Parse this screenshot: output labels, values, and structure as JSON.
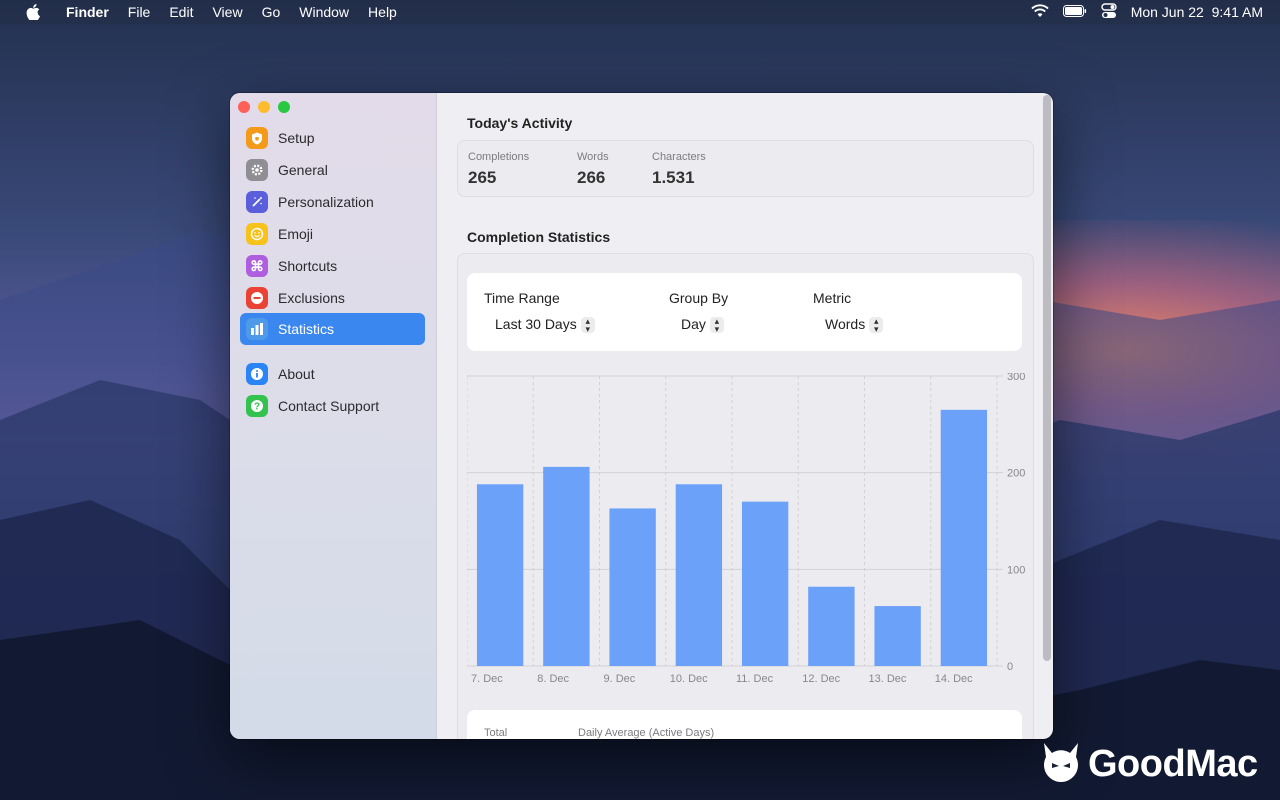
{
  "menubar": {
    "apple_icon": "apple-icon",
    "items": [
      "Finder",
      "File",
      "Edit",
      "View",
      "Go",
      "Window",
      "Help"
    ],
    "status_icons": [
      "wifi-icon",
      "battery-icon",
      "control-center-icon"
    ],
    "datetime": "Mon Jun 22  9:41 AM"
  },
  "sidebar": {
    "items": [
      {
        "label": "Setup",
        "icon": "setup-icon",
        "color": "#f39a1a"
      },
      {
        "label": "General",
        "icon": "gear-icon",
        "color": "#8e8e93"
      },
      {
        "label": "Personalization",
        "icon": "magic-wand-icon",
        "color": "#5b5fdc"
      },
      {
        "label": "Emoji",
        "icon": "smiley-icon",
        "color": "#f6c21b"
      },
      {
        "label": "Shortcuts",
        "icon": "command-icon",
        "color": "#b05ee0"
      },
      {
        "label": "Exclusions",
        "icon": "minus-circle-icon",
        "color": "#ea4335"
      },
      {
        "label": "Statistics",
        "icon": "chart-icon",
        "color": "#4e9ae8",
        "active": true
      },
      {
        "label": "About",
        "icon": "info-icon",
        "color": "#2a84f5"
      },
      {
        "label": "Contact Support",
        "icon": "help-icon",
        "color": "#32c24d"
      }
    ]
  },
  "activity": {
    "title": "Today's Activity",
    "completions_label": "Completions",
    "completions_value": "265",
    "words_label": "Words",
    "words_value": "266",
    "characters_label": "Characters",
    "characters_value": "1.531"
  },
  "stats": {
    "title": "Completion Statistics",
    "time_range_label": "Time Range",
    "time_range_value": "Last 30 Days",
    "group_by_label": "Group By",
    "group_by_value": "Day",
    "metric_label": "Metric",
    "metric_value": "Words"
  },
  "chart_data": {
    "type": "bar",
    "categories": [
      "7. Dec",
      "8. Dec",
      "9. Dec",
      "10. Dec",
      "11. Dec",
      "12. Dec",
      "13. Dec",
      "14. Dec"
    ],
    "values": [
      188,
      206,
      163,
      188,
      170,
      82,
      62,
      265
    ],
    "ylim": [
      0,
      300
    ],
    "yticks": [
      0,
      100,
      200,
      300
    ],
    "grid": true,
    "bar_color": "#6ba1f9"
  },
  "summary": {
    "total_label": "Total",
    "daily_average_label": "Daily Average (Active Days)"
  },
  "watermark": {
    "text": "GoodMac",
    "icon": "goodmac-devil-icon"
  }
}
